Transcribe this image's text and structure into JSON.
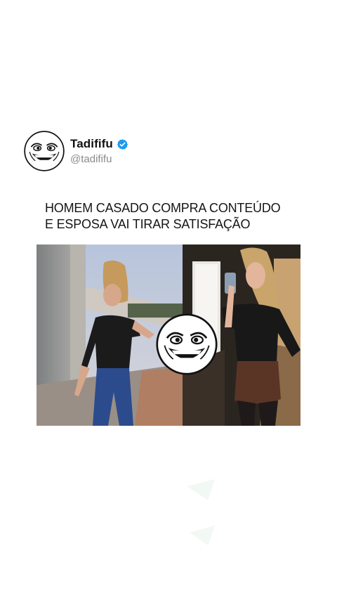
{
  "post": {
    "author": {
      "display_name": "Tadififu",
      "handle": "@tadififu",
      "verified": true,
      "avatar_icon": "troll-face-icon",
      "verified_color": "#1d9bf0"
    },
    "caption_lines": [
      "HOMEM CASADO COMPRA CONTEÚDO",
      "E ESPOSA VAI TIRAR SATISFAÇÃO"
    ],
    "media": {
      "overlay_icon": "troll-face-icon"
    }
  }
}
